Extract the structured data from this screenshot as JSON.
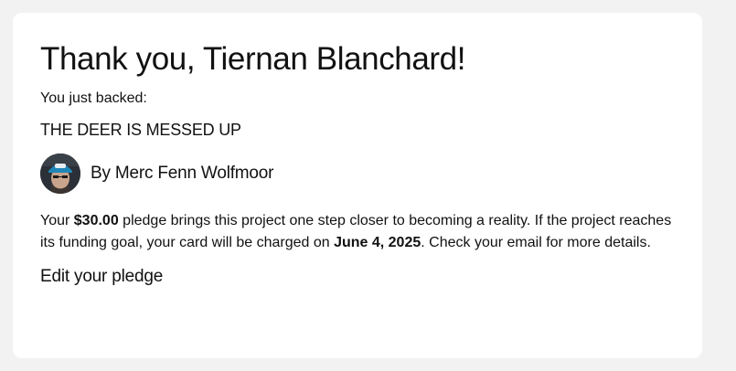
{
  "heading": "Thank you, Tiernan Blanchard!",
  "backed_label": "You just backed:",
  "project": {
    "name": "THE DEER IS MESSED UP"
  },
  "creator": {
    "by_label": "By Merc Fenn Wolfmoor"
  },
  "pledge_message": {
    "part1": "Your ",
    "amount": "$30.00",
    "part2": " pledge brings this project one step closer to becoming a reality. If the project reaches its funding goal, your card will be charged on ",
    "charge_date": "June 4, 2025",
    "part3": ". Check your email for more details."
  },
  "edit_link": "Edit your pledge"
}
